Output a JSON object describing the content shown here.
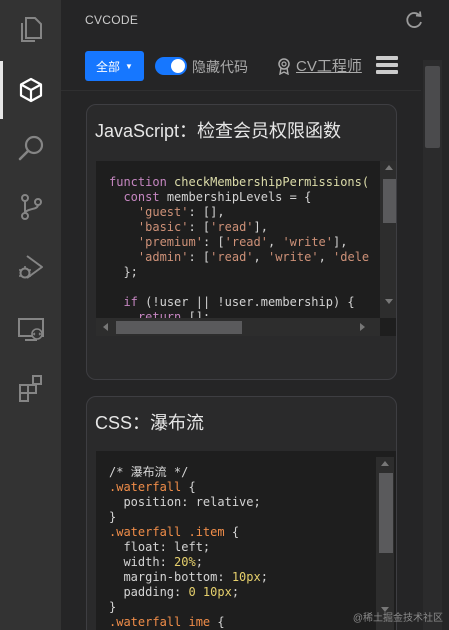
{
  "activity_bar": {
    "items": [
      {
        "icon": "files-icon",
        "active": false
      },
      {
        "icon": "cube-icon",
        "active": true
      },
      {
        "icon": "search-icon",
        "active": false
      },
      {
        "icon": "source-control-icon",
        "active": false
      },
      {
        "icon": "run-debug-icon",
        "active": false
      },
      {
        "icon": "remote-explorer-icon",
        "active": false
      },
      {
        "icon": "extensions-icon",
        "active": false
      }
    ]
  },
  "panel": {
    "title": "CVCODE",
    "refresh_icon": "refresh-icon"
  },
  "toolbar": {
    "filter_label": "全部",
    "hide_code_label": "隐藏代码",
    "hide_code_on": true,
    "user_label": "CV工程师",
    "menu_icon": "hamburger-menu-icon"
  },
  "colors": {
    "accent": "#1677ff",
    "background": "#252526",
    "activity_bar": "#333333",
    "code_background": "#1e1e1e"
  },
  "cards": [
    {
      "title": "JavaScript：检查会员权限函数",
      "code": [
        [
          [
            "kw",
            "function "
          ],
          [
            "fn",
            "checkMembershipPermissions("
          ]
        ],
        [
          [
            "pl",
            "  "
          ],
          [
            "kw",
            "const "
          ],
          [
            "pl",
            "membershipLevels = {"
          ]
        ],
        [
          [
            "pl",
            "    "
          ],
          [
            "str",
            "'guest'"
          ],
          [
            "pl",
            ": [],"
          ]
        ],
        [
          [
            "pl",
            "    "
          ],
          [
            "str",
            "'basic'"
          ],
          [
            "pl",
            ": ["
          ],
          [
            "str",
            "'read'"
          ],
          [
            "pl",
            "],"
          ]
        ],
        [
          [
            "pl",
            "    "
          ],
          [
            "str",
            "'premium'"
          ],
          [
            "pl",
            ": ["
          ],
          [
            "str",
            "'read'"
          ],
          [
            "pl",
            ", "
          ],
          [
            "str",
            "'write'"
          ],
          [
            "pl",
            "],"
          ]
        ],
        [
          [
            "pl",
            "    "
          ],
          [
            "str",
            "'admin'"
          ],
          [
            "pl",
            ": ["
          ],
          [
            "str",
            "'read'"
          ],
          [
            "pl",
            ", "
          ],
          [
            "str",
            "'write'"
          ],
          [
            "pl",
            ", "
          ],
          [
            "str",
            "'dele"
          ]
        ],
        [
          [
            "pl",
            "  };"
          ]
        ],
        [
          [
            "pl",
            ""
          ]
        ],
        [
          [
            "pl",
            "  "
          ],
          [
            "kw",
            "if "
          ],
          [
            "pl",
            "(!user || !user.membership) {"
          ]
        ],
        [
          [
            "pl",
            "    "
          ],
          [
            "kw",
            "return "
          ],
          [
            "pl",
            "[];"
          ]
        ]
      ]
    },
    {
      "title": "CSS：瀑布流",
      "code": [
        [
          [
            "cm",
            "/* 瀑布流 */"
          ]
        ],
        [
          [
            "sel",
            ".waterfall"
          ],
          [
            "pl",
            " {"
          ]
        ],
        [
          [
            "pl",
            "  "
          ],
          [
            "prop",
            "position"
          ],
          [
            "pl",
            ": relative;"
          ]
        ],
        [
          [
            "pl",
            "}"
          ]
        ],
        [
          [
            "sel",
            ".waterfall .item"
          ],
          [
            "pl",
            " {"
          ]
        ],
        [
          [
            "pl",
            "  "
          ],
          [
            "prop",
            "float"
          ],
          [
            "pl",
            ": left;"
          ]
        ],
        [
          [
            "pl",
            "  "
          ],
          [
            "prop",
            "width"
          ],
          [
            "pl",
            ": "
          ],
          [
            "val",
            "20%"
          ],
          [
            "pl",
            ";"
          ]
        ],
        [
          [
            "pl",
            "  "
          ],
          [
            "prop",
            "margin-bottom"
          ],
          [
            "pl",
            ": "
          ],
          [
            "val",
            "10px"
          ],
          [
            "pl",
            ";"
          ]
        ],
        [
          [
            "pl",
            "  "
          ],
          [
            "prop",
            "padding"
          ],
          [
            "pl",
            ": "
          ],
          [
            "val",
            "0 10px"
          ],
          [
            "pl",
            ";"
          ]
        ],
        [
          [
            "pl",
            "}"
          ]
        ],
        [
          [
            "sel",
            ".waterfall ime"
          ],
          [
            "pl",
            " {"
          ]
        ]
      ]
    }
  ],
  "watermark": "@稀土掘金技术社区"
}
